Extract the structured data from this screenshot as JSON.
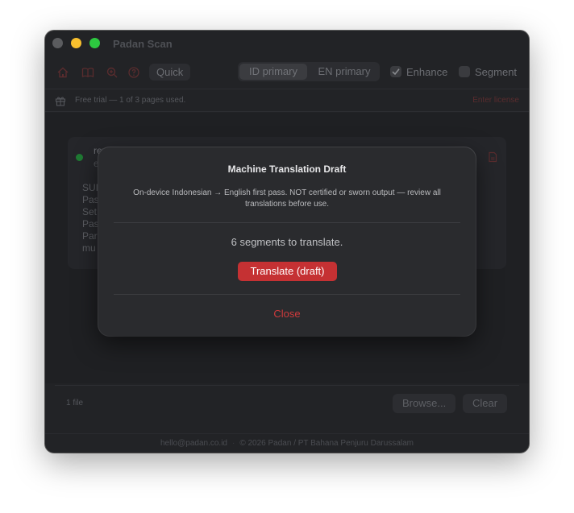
{
  "window": {
    "title": "Padan Scan"
  },
  "toolbar": {
    "icons": [
      "home-icon",
      "book-icon",
      "zoom-icon",
      "help-icon"
    ],
    "quick_label": "Quick",
    "language_options": [
      "ID primary",
      "EN primary"
    ],
    "selected_language": "ID primary",
    "enhance_label": "Enhance",
    "enhance_checked": true,
    "segment_label": "Segment",
    "segment_checked": false
  },
  "trial": {
    "text": "Free trial — 1 of 3 pages used.",
    "license_link": "Enter license"
  },
  "document": {
    "name_fragment": "rev",
    "sub_fragment": "e",
    "lines": [
      "SUI",
      "Pas",
      "Set",
      "Pas",
      "Par",
      "mu"
    ]
  },
  "footer": {
    "file_count": "1 file",
    "browse_label": "Browse...",
    "clear_label": "Clear",
    "email": "hello@padan.co.id",
    "copyright": "© 2026 Padan / PT Bahana Penjuru Darussalam"
  },
  "dialog": {
    "title": "Machine Translation Draft",
    "description": "On-device Indonesian → English first pass. NOT certified or sworn output — review all translations before use.",
    "segments_text": "6 segments to translate.",
    "translate_label": "Translate (draft)",
    "close_label": "Close"
  },
  "colors": {
    "accent_red": "#c53133",
    "window_bg": "#222326",
    "dialog_bg": "#2a2b2e"
  }
}
